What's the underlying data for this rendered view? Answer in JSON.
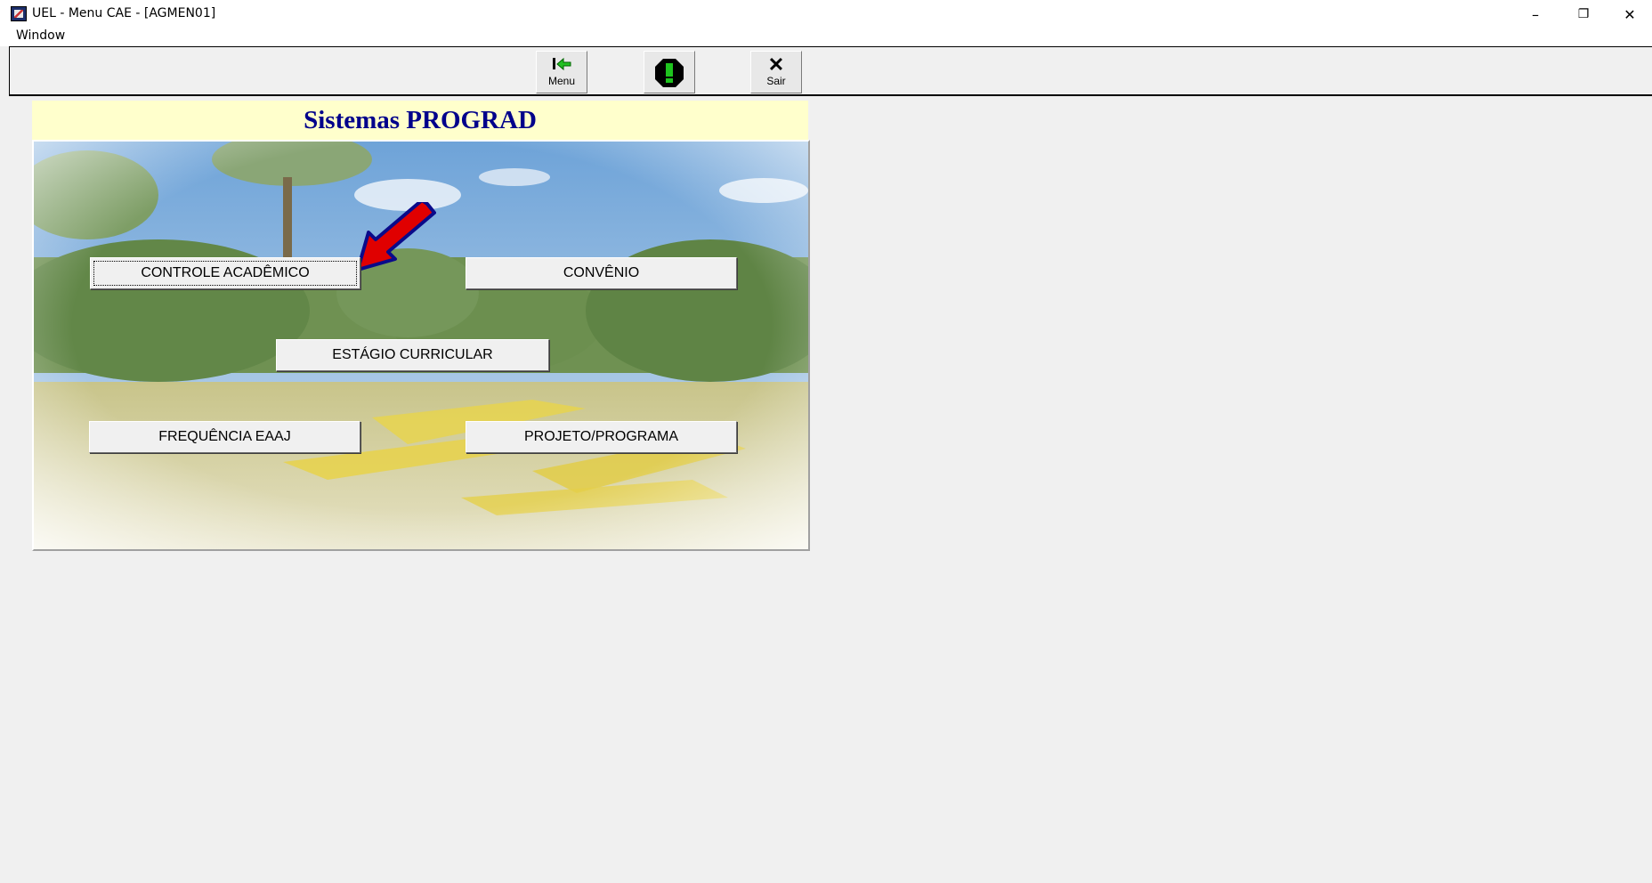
{
  "window": {
    "title": "UEL - Menu CAE - [AGMEN01]",
    "controls": {
      "minimize": "–",
      "restore": "❐",
      "close": "✕"
    }
  },
  "menubar": {
    "window_label": "Window"
  },
  "toolbar": {
    "menu_label": "Menu",
    "sair_label": "Sair"
  },
  "panel": {
    "title": "Sistemas PROGRAD",
    "buttons": {
      "controle_academico": "CONTROLE ACADÊMICO",
      "convenio": "CONVÊNIO",
      "estagio_curricular": "ESTÁGIO CURRICULAR",
      "frequencia_eaaj": "FREQUÊNCIA EAAJ",
      "projeto_programa": "PROJETO/PROGRAMA"
    }
  },
  "colors": {
    "title_text": "#00008b",
    "title_bg": "#ffffcc",
    "arrow": "#e00000",
    "arrow_outline": "#0a0a8a"
  }
}
